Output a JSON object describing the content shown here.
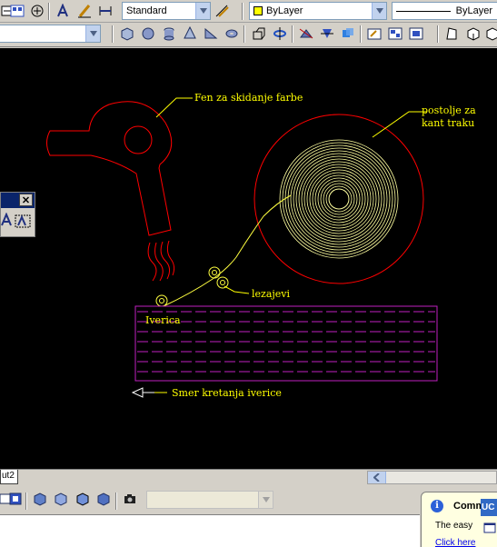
{
  "toolbar_top": {
    "text_style": "Standard",
    "layer": "ByLayer",
    "linetype": "ByLayer",
    "layer_color": "#ffff00"
  },
  "toolbar_second": {
    "combo_value": ""
  },
  "drawing": {
    "labels": {
      "heat_gun": "Fen za skidanje farbe",
      "tape_holder_line1": "postolje za",
      "tape_holder_line2": "kant traku",
      "bearings": "lezajevi",
      "board": "Iverica",
      "direction": "Smer kretanja iverice"
    },
    "colors": {
      "background": "#000000",
      "heat_gun": "#ff0000",
      "tape": "#ffffa0",
      "board": "#c020c0",
      "labels": "#ffff00",
      "arrow": "#ffffff"
    }
  },
  "layout_tab": "ut2",
  "bottom_toolbar": {
    "combo_value": ""
  },
  "balloon": {
    "title": "Comm",
    "body": "The easy",
    "link": "Click here",
    "tab_label": "UC"
  }
}
